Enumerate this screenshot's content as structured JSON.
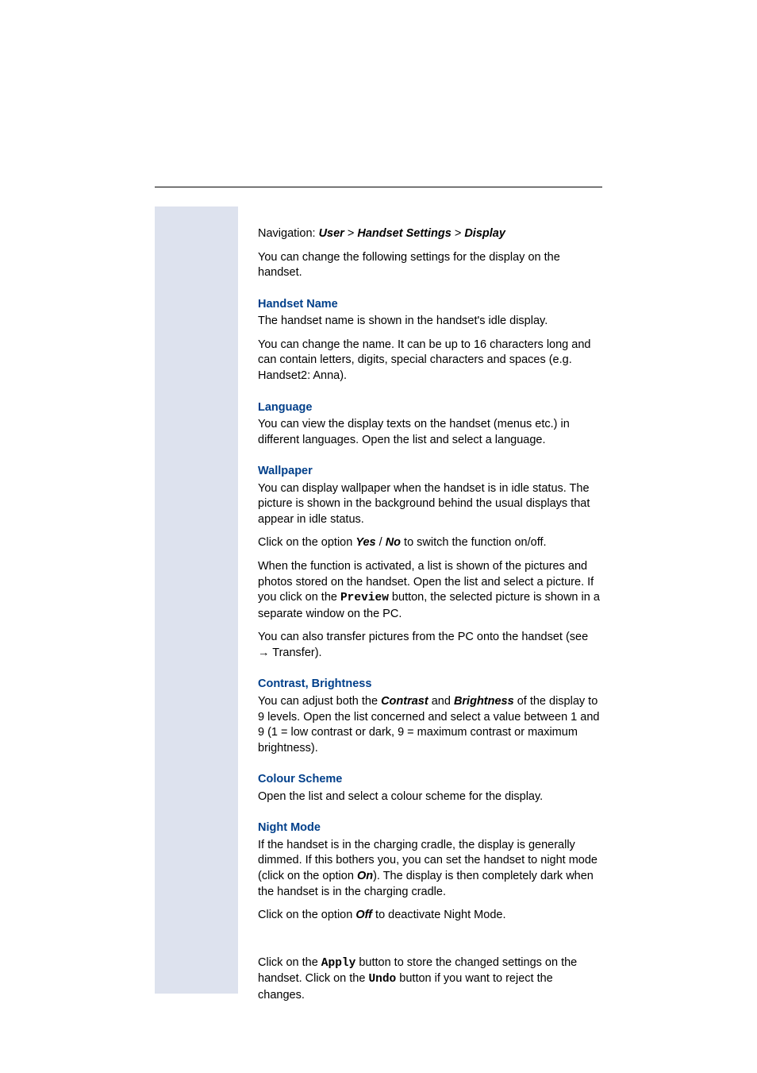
{
  "nav": {
    "prefix": "Navigation: ",
    "p1": "User",
    "sep": " > ",
    "p2": "Handset Settings",
    "p3": "Display"
  },
  "intro": "You can change the following settings for the display on the handset.",
  "handsetName": {
    "heading": "Handset Name",
    "p1": "The handset name is shown in the handset's idle display.",
    "p2": "You can change the name. It can be up to 16 characters long and can contain letters, digits, special characters and spaces (e.g. Handset2: Anna)."
  },
  "language": {
    "heading": "Language",
    "p1": "You can view the display texts on the handset (menus etc.) in different languages. Open the list and select a language."
  },
  "wallpaper": {
    "heading": "Wallpaper",
    "p1": "You can display wallpaper when the handset is in idle status. The picture is shown in the background behind the usual displays that appear in idle status.",
    "p2a": "Click on the option ",
    "yes": "Yes",
    "slash": " / ",
    "no": "No",
    "p2b": " to switch the function on/off.",
    "p3a": "When the function is activated, a list is shown of the pictures and photos stored on the handset. Open the list and select a picture. If you click on the ",
    "preview": "Preview",
    "p3b": " button, the selected picture is shown in a separate window on the PC.",
    "p4a": "You can also transfer pictures from the PC onto the handset (see ",
    "arrow": "→",
    "p4b": " Transfer)."
  },
  "contrast": {
    "heading": "Contrast, Brightness",
    "p1a": "You can adjust both the ",
    "c": "Contrast",
    "and": " and ",
    "b": "Brightness",
    "p1b": " of the display to 9 levels. Open the list concerned and select a value between 1 and 9 (1 = low contrast or dark, 9 = maximum contrast or maximum brightness)."
  },
  "colour": {
    "heading": "Colour Scheme",
    "p1": "Open the list and select a colour scheme for the display."
  },
  "night": {
    "heading": "Night Mode",
    "p1a": "If the handset is in the charging cradle, the display is generally dimmed. If this bothers you, you can set the handset to night mode (click on the option ",
    "on": "On",
    "p1b": "). The display is then completely dark when the handset is in the charging cradle.",
    "p2a": "Click on the option ",
    "off": "Off",
    "p2b": " to deactivate Night Mode."
  },
  "footer": {
    "p1a": "Click on the ",
    "apply": "Apply",
    "p1b": " button to store the changed settings on the handset. Click on the ",
    "undo": "Undo",
    "p1c": " button if you want to reject the changes."
  }
}
